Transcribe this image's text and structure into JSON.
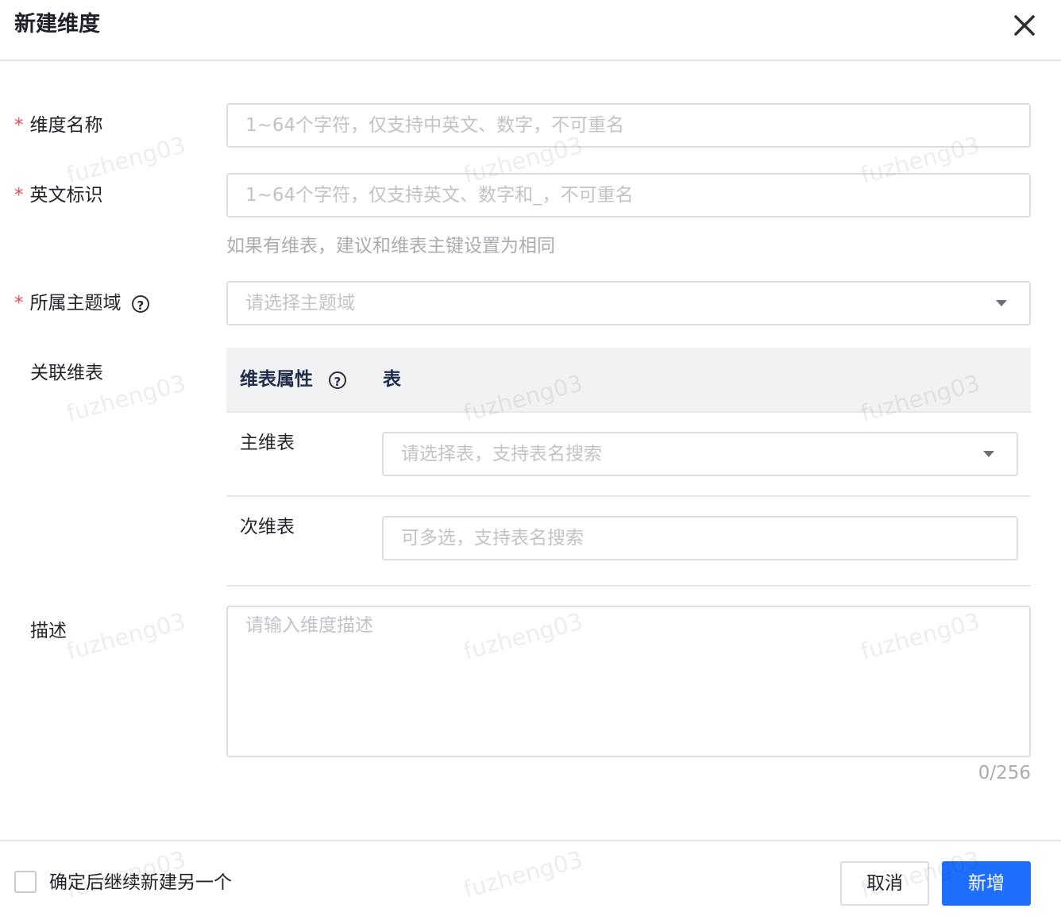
{
  "dialog": {
    "title": "新建维度",
    "close_icon": "close-icon"
  },
  "fields": {
    "name": {
      "required_mark": "*",
      "label": "维度名称",
      "placeholder": "1~64个字符，仅支持中英文、数字，不可重名"
    },
    "english_id": {
      "required_mark": "*",
      "label": "英文标识",
      "placeholder": "1~64个字符，仅支持英文、数字和_，不可重名",
      "hint": "如果有维表，建议和维表主键设置为相同"
    },
    "subject_domain": {
      "required_mark": "*",
      "label": "所属主题域",
      "help_glyph": "?",
      "placeholder": "请选择主题域"
    },
    "related_tables": {
      "label": "关联维表",
      "header_attr": "维表属性",
      "header_help_glyph": "?",
      "header_table": "表",
      "rows": [
        {
          "label": "主维表",
          "placeholder": "请选择表，支持表名搜索"
        },
        {
          "label": "次维表",
          "placeholder": "可多选，支持表名搜索"
        }
      ]
    },
    "description": {
      "label": "描述",
      "placeholder": "请输入维度描述",
      "counter": "0/256"
    }
  },
  "footer": {
    "continue_label": "确定后继续新建另一个",
    "cancel_label": "取消",
    "submit_label": "新增"
  },
  "watermark": "fuzheng03",
  "colors": {
    "primary": "#1e6fff",
    "required": "#e34d59",
    "placeholder": "#c0c3c8",
    "header_bg": "#f1f2f4"
  }
}
